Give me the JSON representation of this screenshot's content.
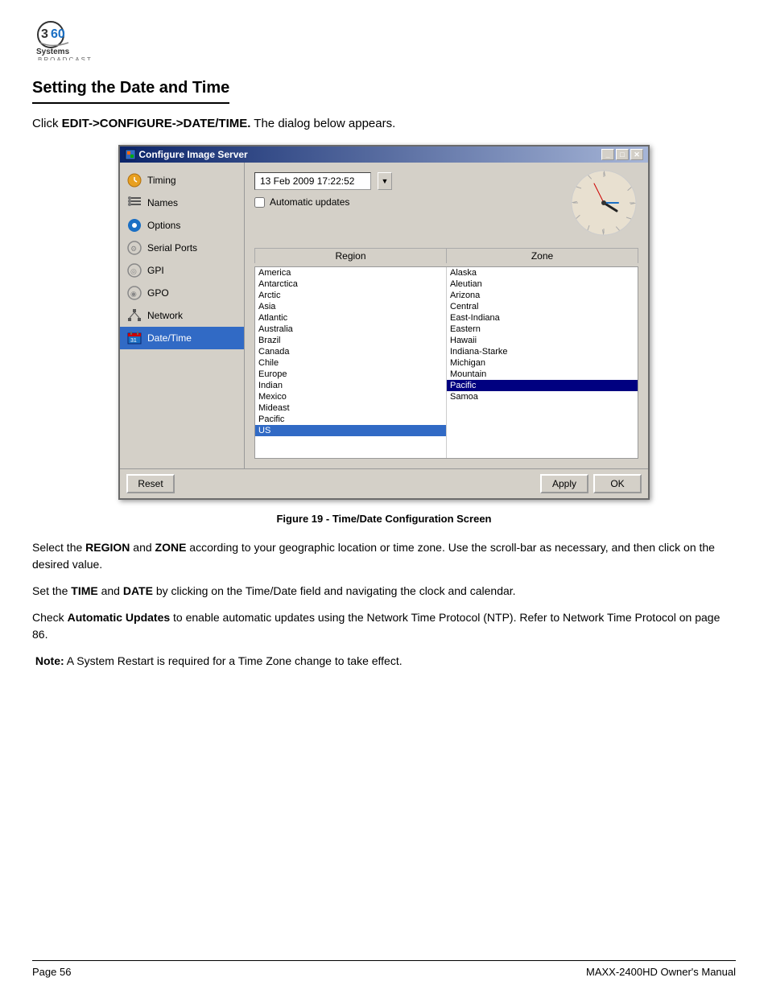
{
  "logo": {
    "alt": "360 Systems Broadcast"
  },
  "page": {
    "title": "Setting the Date and Time",
    "instruction_prefix": "Click ",
    "instruction_bold": "EDIT->CONFIGURE->DATE/TIME.",
    "instruction_suffix": " The dialog below appears."
  },
  "dialog": {
    "title": "Configure Image Server",
    "titlebar_icon": "■",
    "buttons": {
      "minimize": "_",
      "maximize": "□",
      "close": "✕"
    }
  },
  "sidebar": {
    "items": [
      {
        "id": "timing",
        "label": "Timing",
        "icon": "clock"
      },
      {
        "id": "names",
        "label": "Names",
        "icon": "list"
      },
      {
        "id": "options",
        "label": "Options",
        "icon": "gear"
      },
      {
        "id": "serial-ports",
        "label": "Serial Ports",
        "icon": "plug"
      },
      {
        "id": "gpi",
        "label": "GPI",
        "icon": "arrow"
      },
      {
        "id": "gpo",
        "label": "GPO",
        "icon": "arrow"
      },
      {
        "id": "network",
        "label": "Network",
        "icon": "network"
      },
      {
        "id": "datetime",
        "label": "Date/Time",
        "icon": "calendar",
        "active": true
      }
    ]
  },
  "main": {
    "datetime_value": "13 Feb 2009 17:22:52",
    "datetime_placeholder": "13 Feb 2009 17:22:52",
    "auto_update_label": "Automatic updates",
    "region_header": "Region",
    "zone_header": "Zone",
    "regions": [
      "America",
      "Antarctica",
      "Arctic",
      "Asia",
      "Atlantic",
      "Australia",
      "Brazil",
      "Canada",
      "Chile",
      "Europe",
      "Indian",
      "Mexico",
      "Mideast",
      "Pacific",
      "US"
    ],
    "zones": [
      "Alaska",
      "Aleutian",
      "Arizona",
      "Central",
      "East-Indiana",
      "Eastern",
      "Hawaii",
      "Indiana-Starke",
      "Michigan",
      "Mountain",
      "Pacific",
      "Samoa"
    ],
    "selected_region": "US",
    "selected_zone": "Pacific"
  },
  "footer": {
    "reset_label": "Reset",
    "apply_label": "Apply",
    "ok_label": "OK"
  },
  "figure_caption": "Figure 19 - Time/Date Configuration Screen",
  "body_paragraphs": [
    {
      "text": "Select the REGION and ZONE according to your geographic location or time zone. Use the scroll-bar as necessary, and then click on the desired value.",
      "bold_words": [
        "REGION",
        "ZONE"
      ]
    },
    {
      "text": "Set the TIME and DATE by clicking on the Time/Date field and navigating the clock and calendar.",
      "bold_words": [
        "TIME",
        "DATE"
      ]
    },
    {
      "text": "Check Automatic Updates to enable automatic updates using the Network Time Protocol (NTP). Refer to Network Time Protocol on page 86.",
      "bold_words": [
        "Automatic Updates"
      ]
    }
  ],
  "note": {
    "label": "Note:",
    "text": "A System Restart is required for a Time Zone change to take effect."
  },
  "page_footer": {
    "left": "Page 56",
    "right": "MAXX-2400HD Owner's Manual"
  }
}
